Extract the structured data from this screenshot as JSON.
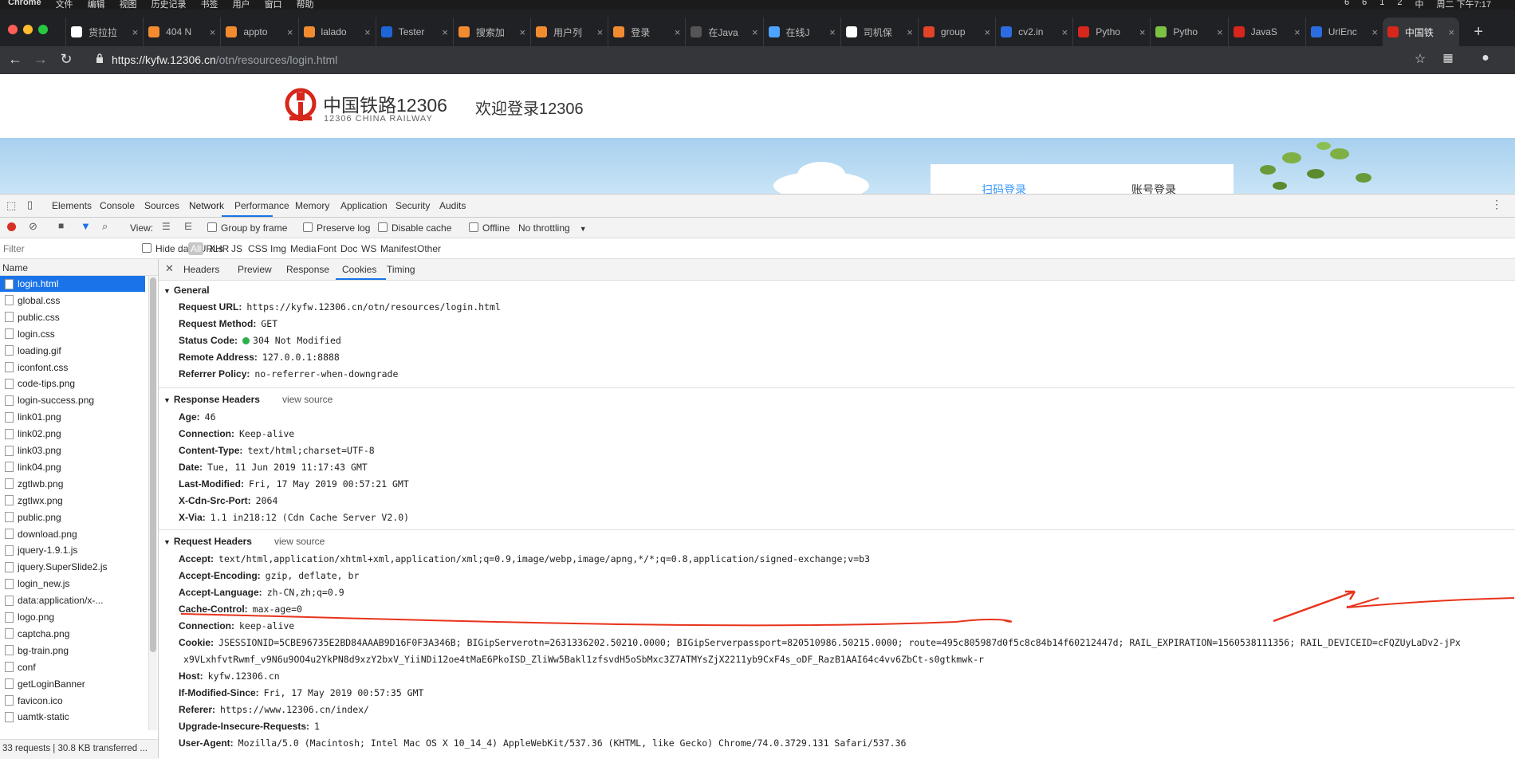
{
  "menubar": {
    "items": [
      "Chrome",
      "文件",
      "编辑",
      "视图",
      "历史记录",
      "书签",
      "用户",
      "窗口",
      "帮助"
    ],
    "right": [
      "6",
      "6",
      "1",
      "2",
      "中",
      "周二 下午7:17"
    ]
  },
  "tabs": [
    {
      "title": "货拉拉",
      "color": "#ffffff"
    },
    {
      "title": "404 N",
      "color": "#f28b30"
    },
    {
      "title": "appto",
      "color": "#f28b30"
    },
    {
      "title": "lalado",
      "color": "#f28b30"
    },
    {
      "title": "Tester",
      "color": "#1e66d8"
    },
    {
      "title": "搜索加",
      "color": "#f28b30"
    },
    {
      "title": "用户列",
      "color": "#f28b30"
    },
    {
      "title": "登录",
      "color": "#f28b30"
    },
    {
      "title": "在Java",
      "color": "#555555"
    },
    {
      "title": "在线J",
      "color": "#4da3ff"
    },
    {
      "title": "司机保",
      "color": "#ffffff"
    },
    {
      "title": "group",
      "color": "#e24329"
    },
    {
      "title": "cv2.in",
      "color": "#2b6de0"
    },
    {
      "title": "Pytho",
      "color": "#d7261b"
    },
    {
      "title": "Pytho",
      "color": "#7cc242"
    },
    {
      "title": "JavaS",
      "color": "#d7261b"
    },
    {
      "title": "UrlEnc",
      "color": "#2b6de0"
    },
    {
      "title": "中国铁",
      "color": "#d7261b"
    }
  ],
  "address": {
    "scheme_host": "https://kyfw.12306.cn",
    "path": "/otn/resources/login.html"
  },
  "page": {
    "brand": "中国铁路12306",
    "brand_en": "12306 CHINA RAILWAY",
    "welcome": "欢迎登录12306",
    "login_tabs": [
      "扫码登录",
      "账号登录"
    ]
  },
  "devtools": {
    "tabs": [
      "Elements",
      "Console",
      "Sources",
      "Network",
      "Performance",
      "Memory",
      "Application",
      "Security",
      "Audits"
    ],
    "toolbar": {
      "view": "View:",
      "group_by_frame": "Group by frame",
      "preserve_log": "Preserve log",
      "disable_cache": "Disable cache",
      "offline": "Offline",
      "throttling": "No throttling"
    },
    "filterbar": {
      "placeholder": "Filter",
      "hide_data_urls": "Hide data URLs",
      "types": [
        "All",
        "XHR",
        "JS",
        "CSS",
        "Img",
        "Media",
        "Font",
        "Doc",
        "WS",
        "Manifest",
        "Other"
      ]
    },
    "name_header": "Name",
    "requests": [
      "login.html",
      "global.css",
      "public.css",
      "login.css",
      "loading.gif",
      "iconfont.css",
      "code-tips.png",
      "login-success.png",
      "link01.png",
      "link02.png",
      "link03.png",
      "link04.png",
      "zgtlwb.png",
      "zgtlwx.png",
      "public.png",
      "download.png",
      "jquery-1.9.1.js",
      "jquery.SuperSlide2.js",
      "login_new.js",
      "data:application/x-...",
      "logo.png",
      "captcha.png",
      "bg-train.png",
      "conf",
      "getLoginBanner",
      "favicon.ico",
      "uamtk-static"
    ],
    "status": "33 requests | 30.8 KB transferred ...",
    "subtabs": [
      "Headers",
      "Preview",
      "Response",
      "Cookies",
      "Timing"
    ],
    "general": {
      "title": "General",
      "rows": [
        {
          "k": "Request URL:",
          "v": "https://kyfw.12306.cn/otn/resources/login.html"
        },
        {
          "k": "Request Method:",
          "v": "GET"
        },
        {
          "k": "Status Code:",
          "v": "304 Not Modified"
        },
        {
          "k": "Remote Address:",
          "v": "127.0.0.1:8888"
        },
        {
          "k": "Referrer Policy:",
          "v": "no-referrer-when-downgrade"
        }
      ]
    },
    "response_headers": {
      "title": "Response Headers",
      "view_source": "view source",
      "rows": [
        {
          "k": "Age:",
          "v": "46"
        },
        {
          "k": "Connection:",
          "v": "Keep-alive"
        },
        {
          "k": "Content-Type:",
          "v": "text/html;charset=UTF-8"
        },
        {
          "k": "Date:",
          "v": "Tue, 11 Jun 2019 11:17:43 GMT"
        },
        {
          "k": "Last-Modified:",
          "v": "Fri, 17 May 2019 00:57:21 GMT"
        },
        {
          "k": "X-Cdn-Src-Port:",
          "v": "2064"
        },
        {
          "k": "X-Via:",
          "v": "1.1 in218:12 (Cdn Cache Server V2.0)"
        }
      ]
    },
    "request_headers": {
      "title": "Request Headers",
      "view_source": "view source",
      "rows": [
        {
          "k": "Accept:",
          "v": "text/html,application/xhtml+xml,application/xml;q=0.9,image/webp,image/apng,*/*;q=0.8,application/signed-exchange;v=b3"
        },
        {
          "k": "Accept-Encoding:",
          "v": "gzip, deflate, br"
        },
        {
          "k": "Accept-Language:",
          "v": "zh-CN,zh;q=0.9"
        },
        {
          "k": "Cache-Control:",
          "v": "max-age=0"
        },
        {
          "k": "Connection:",
          "v": "keep-alive"
        },
        {
          "k": "Cookie:",
          "v": "JSESSIONID=5CBE96735E2BD84AAAB9D16F0F3A346B; BIGipServerotn=2631336202.50210.0000; BIGipServerpassport=820510986.50215.0000; route=495c805987d0f5c8c84b14f60212447d; RAIL_EXPIRATION=1560538111356; RAIL_DEVICEID=cFQZUyLaDv2-jPx"
        },
        {
          "k": "",
          "v": "x9VLxhfvtRwmf_v9N6u9OO4u2YkPN8d9xzY2bxV_YiiNDi12oe4tMaE6PkoISD_ZliWw5Bakl1zfsvdH5oSbMxc3Z7ATMYsZjX2211yb9CxF4s_oDF_RazB1AAI64c4vv6ZbCt-s0gtkmwk-r"
        },
        {
          "k": "Host:",
          "v": "kyfw.12306.cn"
        },
        {
          "k": "If-Modified-Since:",
          "v": "Fri, 17 May 2019 00:57:35 GMT"
        },
        {
          "k": "Referer:",
          "v": "https://www.12306.cn/index/"
        },
        {
          "k": "Upgrade-Insecure-Requests:",
          "v": "1"
        },
        {
          "k": "User-Agent:",
          "v": "Mozilla/5.0 (Macintosh; Intel Mac OS X 10_14_4) AppleWebKit/537.36 (KHTML, like Gecko) Chrome/74.0.3729.131 Safari/537.36"
        }
      ]
    }
  }
}
